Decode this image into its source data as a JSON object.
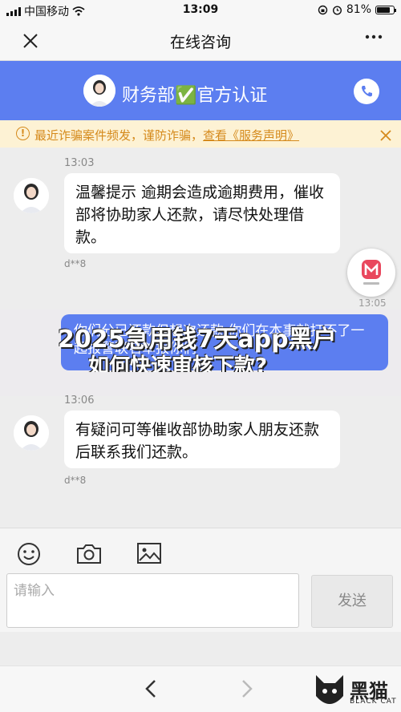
{
  "status_bar": {
    "carrier": "中国移动",
    "time": "13:09",
    "battery": "81%",
    "battery_level": 0.81
  },
  "nav": {
    "title": "在线咨询"
  },
  "header": {
    "name": "财务部✅官方认证"
  },
  "notice": {
    "text": "最近诈骗案件频发，谨防诈骗，",
    "link": "查看《服务声明》"
  },
  "messages": [
    {
      "time": "13:03",
      "text": "温馨提示 逾期会造成逾期费用，催收部将协助家人还款，请尽快处理借款。",
      "user": "d**8"
    },
    {
      "time": "13:06",
      "text": "有疑问可等催收部协助家人朋友还款后联系我们还款。",
      "user": "d**8"
    }
  ],
  "overlay": {
    "time": "13:05",
    "bubble_text": "你们分已还款但想次还款 你们在本事就打不了一起报警联名单报你们",
    "title": "2025急用钱7天app黑户",
    "subtitle": "如何快速审核下款?"
  },
  "input": {
    "placeholder": "请输入",
    "send_label": "发送"
  },
  "watermark": {
    "text": "黑猫",
    "sub": "BLACK CAT"
  }
}
